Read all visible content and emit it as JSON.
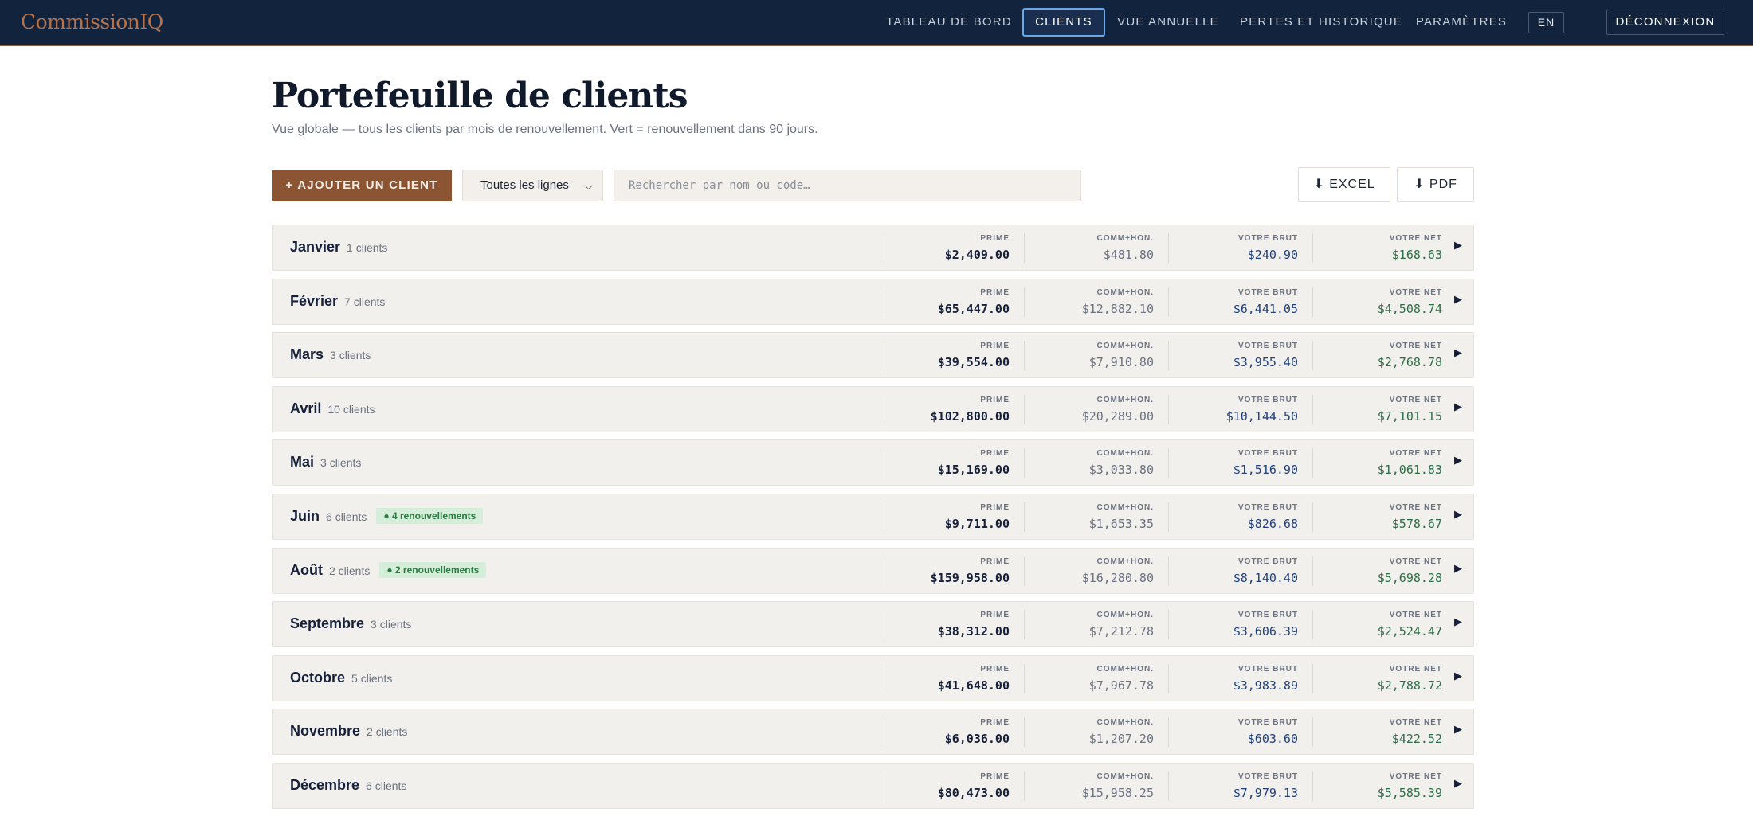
{
  "app": {
    "logo": "CommissionIQ"
  },
  "nav": {
    "items": [
      {
        "label": "TABLEAU DE BORD"
      },
      {
        "label": "CLIENTS"
      },
      {
        "label": "VUE ANNUELLE"
      },
      {
        "label": "PERTES ET HISTORIQUE"
      },
      {
        "label": "PARAMÈTRES"
      }
    ],
    "active_item": "CLIENTS",
    "lang": "EN",
    "logout": "DÉCONNEXION"
  },
  "header": {
    "title": "Portefeuille de clients",
    "subtitle": "Vue globale — tous les clients par mois de renouvellement. Vert = renouvellement dans 90 jours."
  },
  "toolbar": {
    "add_label": "+ AJOUTER UN CLIENT",
    "filter_value": "Toutes les lignes",
    "search_placeholder": "Rechercher par nom ou code…",
    "excel_label": "EXCEL",
    "pdf_label": "PDF"
  },
  "columns": {
    "prime": "PRIME",
    "comm": "COMM+HON.",
    "brut": "VOTRE BRUT",
    "net": "VOTRE NET"
  },
  "months": [
    {
      "name": "Janvier",
      "count": "1 clients",
      "renewals": "",
      "prime": "$2,409.00",
      "comm": "$481.80",
      "brut": "$240.90",
      "net": "$168.63"
    },
    {
      "name": "Février",
      "count": "7 clients",
      "renewals": "",
      "prime": "$65,447.00",
      "comm": "$12,882.10",
      "brut": "$6,441.05",
      "net": "$4,508.74"
    },
    {
      "name": "Mars",
      "count": "3 clients",
      "renewals": "",
      "prime": "$39,554.00",
      "comm": "$7,910.80",
      "brut": "$3,955.40",
      "net": "$2,768.78"
    },
    {
      "name": "Avril",
      "count": "10 clients",
      "renewals": "",
      "prime": "$102,800.00",
      "comm": "$20,289.00",
      "brut": "$10,144.50",
      "net": "$7,101.15"
    },
    {
      "name": "Mai",
      "count": "3 clients",
      "renewals": "",
      "prime": "$15,169.00",
      "comm": "$3,033.80",
      "brut": "$1,516.90",
      "net": "$1,061.83"
    },
    {
      "name": "Juin",
      "count": "6 clients",
      "renewals": "● 4 renouvellements",
      "prime": "$9,711.00",
      "comm": "$1,653.35",
      "brut": "$826.68",
      "net": "$578.67"
    },
    {
      "name": "Août",
      "count": "2 clients",
      "renewals": "● 2 renouvellements",
      "prime": "$159,958.00",
      "comm": "$16,280.80",
      "brut": "$8,140.40",
      "net": "$5,698.28"
    },
    {
      "name": "Septembre",
      "count": "3 clients",
      "renewals": "",
      "prime": "$38,312.00",
      "comm": "$7,212.78",
      "brut": "$3,606.39",
      "net": "$2,524.47"
    },
    {
      "name": "Octobre",
      "count": "5 clients",
      "renewals": "",
      "prime": "$41,648.00",
      "comm": "$7,967.78",
      "brut": "$3,983.89",
      "net": "$2,788.72"
    },
    {
      "name": "Novembre",
      "count": "2 clients",
      "renewals": "",
      "prime": "$6,036.00",
      "comm": "$1,207.20",
      "brut": "$603.60",
      "net": "$422.52"
    },
    {
      "name": "Décembre",
      "count": "6 clients",
      "renewals": "",
      "prime": "$80,473.00",
      "comm": "$15,958.25",
      "brut": "$7,979.13",
      "net": "$5,585.39"
    }
  ],
  "icons": {
    "download": "download-arrow-icon",
    "expand": "expand-triangle-icon",
    "dropdown": "chevron-down-icon"
  }
}
